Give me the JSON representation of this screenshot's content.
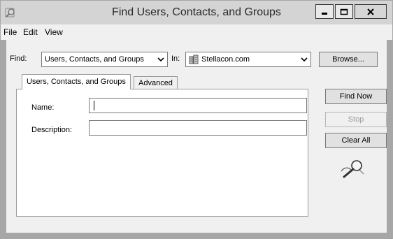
{
  "window": {
    "title": "Find Users, Contacts, and Groups",
    "controls": {
      "minimize": "minimize-icon",
      "maximize": "maximize-icon",
      "close": "close-icon"
    }
  },
  "menu": [
    "File",
    "Edit",
    "View"
  ],
  "find_row": {
    "find_label": "Find:",
    "find_value": "Users, Contacts, and Groups",
    "in_label": "In:",
    "in_value": "Stellacon.com",
    "browse_label": "Browse..."
  },
  "tabs": [
    {
      "label": "Users, Contacts, and Groups",
      "active": true
    },
    {
      "label": "Advanced",
      "active": false
    }
  ],
  "form": {
    "name_label": "Name:",
    "name_value": "",
    "description_label": "Description:",
    "description_value": ""
  },
  "actions": {
    "find_now": "Find Now",
    "stop": "Stop",
    "clear_all": "Clear All",
    "search_graphic": "magnifier-icon"
  },
  "colors": {
    "titlebar": "#d4d4d4",
    "client": "#f0f0f0",
    "border": "#a7a7a7"
  }
}
